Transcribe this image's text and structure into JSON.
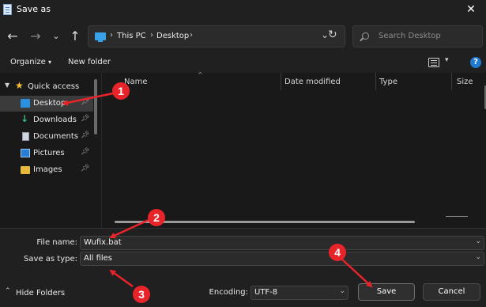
{
  "window": {
    "title": "Save as"
  },
  "address": {
    "crumbs": [
      "This PC",
      "Desktop"
    ]
  },
  "search": {
    "placeholder": "Search Desktop"
  },
  "toolbar": {
    "organize": "Organize",
    "new_folder": "New folder"
  },
  "sidebar": {
    "quick_access": "Quick access",
    "items": [
      {
        "label": "Desktop",
        "icon": "desktop-icon",
        "pinned": true,
        "selected": true
      },
      {
        "label": "Downloads",
        "icon": "download-icon",
        "pinned": true
      },
      {
        "label": "Documents",
        "icon": "documents-icon",
        "pinned": true
      },
      {
        "label": "Pictures",
        "icon": "pictures-icon",
        "pinned": true
      },
      {
        "label": "Images",
        "icon": "folder-icon",
        "pinned": true
      }
    ]
  },
  "columns": {
    "name": "Name",
    "date": "Date modified",
    "type": "Type",
    "size": "Size"
  },
  "form": {
    "file_name_label": "File name:",
    "file_name_value": "Wufix.bat",
    "save_type_label": "Save as type:",
    "save_type_value": "All files",
    "encoding_label": "Encoding:",
    "encoding_value": "UTF-8"
  },
  "footer": {
    "hide_folders": "Hide Folders",
    "save": "Save",
    "cancel": "Cancel"
  },
  "annotations": [
    "1",
    "2",
    "3",
    "4"
  ],
  "colors": {
    "annotation": "#e8242b",
    "accent": "#2d8fe0",
    "background": "#1c1c1c"
  }
}
